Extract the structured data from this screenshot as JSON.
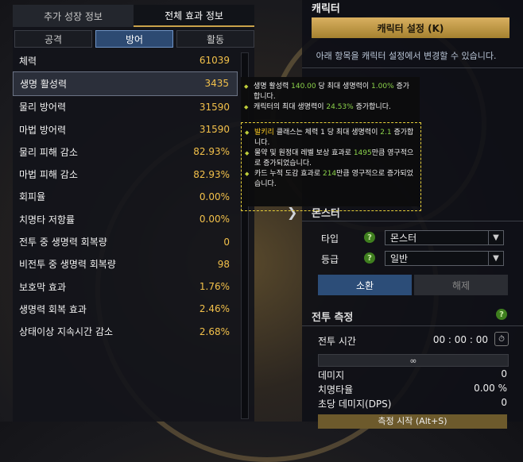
{
  "left": {
    "tabs": [
      "추가 성장 정보",
      "전체 효과 정보"
    ],
    "subtabs": [
      "공격",
      "방어",
      "활동"
    ],
    "stats": [
      {
        "label": "체력",
        "value": "61039"
      },
      {
        "label": "생명 활성력",
        "value": "3435"
      },
      {
        "label": "물리 방어력",
        "value": "31590"
      },
      {
        "label": "마법 방어력",
        "value": "31590"
      },
      {
        "label": "물리 피해 감소",
        "value": "82.93%"
      },
      {
        "label": "마법 피해 감소",
        "value": "82.93%"
      },
      {
        "label": "회피율",
        "value": "0.00%"
      },
      {
        "label": "치명타 저항률",
        "value": "0.00%"
      },
      {
        "label": "전투 중 생명력 회복량",
        "value": "0"
      },
      {
        "label": "비전투 중 생명력 회복량",
        "value": "98"
      },
      {
        "label": "보호막 효과",
        "value": "1.76%"
      },
      {
        "label": "생명력 회복 효과",
        "value": "2.46%"
      },
      {
        "label": "상태이상 지속시간 감소",
        "value": "2.68%"
      }
    ]
  },
  "tooltip": {
    "l1a": "생명 활성력 ",
    "l1b": "140.00",
    "l1c": " 당 최대 생명력이 ",
    "l1d": "1.00%",
    "l1e": " 증가합니다.",
    "l2a": "캐릭터의 최대 생명력이 ",
    "l2b": "24.53%",
    "l2c": " 증가합니다.",
    "l3a": "발키리",
    "l3b": " 클래스는 체력 1 당 최대 생명력이 ",
    "l3c": "2.1",
    "l3d": " 증가합니다.",
    "l4a": "물약 및 원정대 레벨 보상 효과로 ",
    "l4b": "1495",
    "l4c": "만큼 영구적으로 증가되었습니다.",
    "l5a": "카드 누적 도감 효과로 ",
    "l5b": "214",
    "l5c": "만큼 영구적으로 증가되었습니다."
  },
  "right": {
    "title": "캐릭터",
    "settings_button": "캐릭터 설정 (K)",
    "info": "아래 항목을 캐릭터 설정에서 변경할 수 있습니다.",
    "summon_title": "몬스터",
    "type_label": "타입",
    "type_value": "몬스터",
    "grade_label": "등급",
    "grade_value": "일반",
    "summon_button": "소환",
    "release_button": "해제",
    "combat_title": "전투 측정",
    "combat_time_label": "전투 시간",
    "combat_time_value": "00 : 00 : 00",
    "infinity": "∞",
    "damage_label": "데미지",
    "damage_value": "0",
    "crit_label": "치명타율",
    "crit_value": "0.00 %",
    "dps_label": "초당 데미지(DPS)",
    "dps_value": "0",
    "bottom_button": "측정 시작 (Alt+S)"
  }
}
